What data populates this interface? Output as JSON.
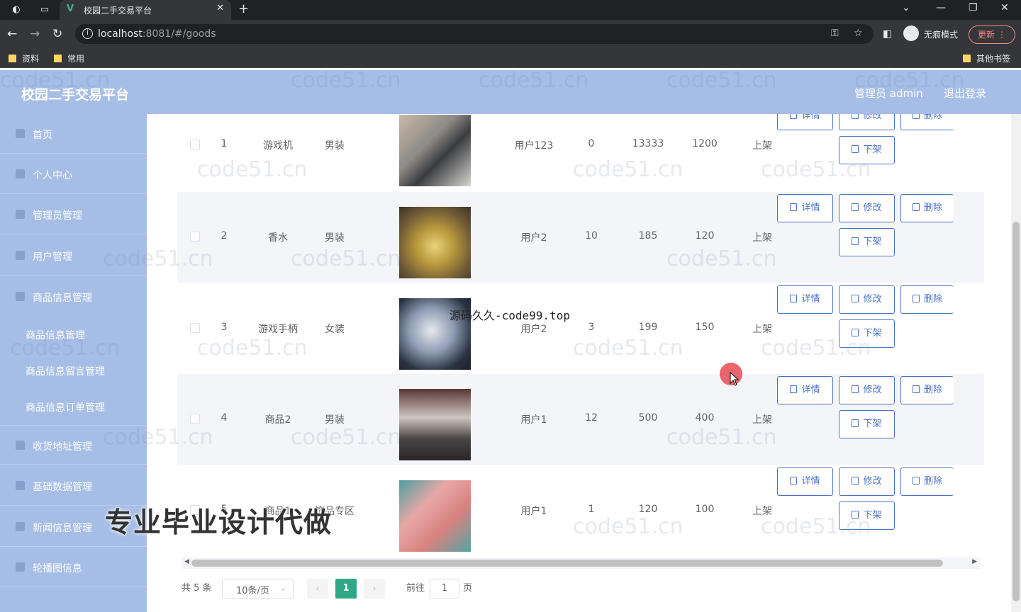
{
  "browser": {
    "tab_title": "校园二手交易平台",
    "url_host": "localhost",
    "url_rest": ":8081/#/goods",
    "incognito_label": "无痕模式",
    "update_label": "更新",
    "bookmarks": [
      "资料",
      "常用"
    ],
    "other_bookmarks": "其他书签"
  },
  "header": {
    "title": "校园二手交易平台",
    "admin_label": "管理员 admin",
    "logout_label": "退出登录"
  },
  "sidebar": {
    "items": [
      {
        "label": "首页"
      },
      {
        "label": "个人中心"
      },
      {
        "label": "管理员管理"
      },
      {
        "label": "用户管理"
      },
      {
        "label": "商品信息管理"
      }
    ],
    "subitems": [
      {
        "label": "商品信息管理"
      },
      {
        "label": "商品信息留言管理"
      },
      {
        "label": "商品信息订单管理"
      }
    ],
    "items2": [
      {
        "label": "收货地址管理"
      },
      {
        "label": "基础数据管理"
      },
      {
        "label": "新闻信息管理"
      },
      {
        "label": "轮播图信息"
      }
    ]
  },
  "table": {
    "rows": [
      {
        "index": "1",
        "name": "游戏机",
        "type": "男装",
        "user": "用户123",
        "num": "0",
        "price1": "13333",
        "price2": "1200",
        "status": "上架"
      },
      {
        "index": "2",
        "name": "香水",
        "type": "男装",
        "user": "用户2",
        "num": "10",
        "price1": "185",
        "price2": "120",
        "status": "上架"
      },
      {
        "index": "3",
        "name": "游戏手柄",
        "type": "女装",
        "user": "用户2",
        "num": "3",
        "price1": "199",
        "price2": "150",
        "status": "上架"
      },
      {
        "index": "4",
        "name": "商品2",
        "type": "男装",
        "user": "用户1",
        "num": "12",
        "price1": "500",
        "price2": "400",
        "status": "上架"
      },
      {
        "index": "5",
        "name": "商品1",
        "type": "饰品专区",
        "user": "用户1",
        "num": "1",
        "price1": "120",
        "price2": "100",
        "status": "上架"
      }
    ],
    "actions": {
      "detail": "详情",
      "edit": "修改",
      "delete": "删除",
      "offshelf": "下架"
    }
  },
  "pagination": {
    "total_text": "共 5 条",
    "page_size": "10条/页",
    "current_page": "1",
    "goto_prefix": "前往",
    "goto_value": "1",
    "goto_suffix": "页"
  },
  "overlays": {
    "source_text": "源码久久-code99.top",
    "promo_text": "专业毕业设计代做",
    "watermark": "code51.cn"
  },
  "colors": {
    "header_bg": "#a6bde6",
    "primary": "#4b73c9",
    "page_active": "#2fa886"
  }
}
